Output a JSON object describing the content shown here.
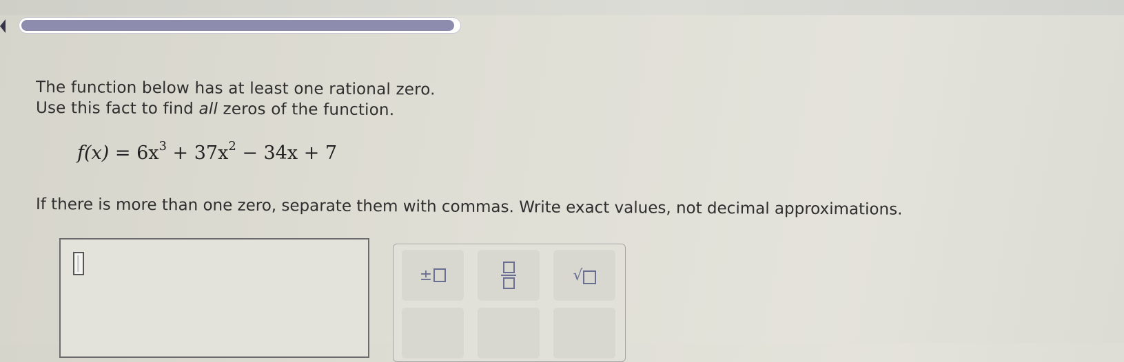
{
  "progress": {
    "value_percent": 99
  },
  "question": {
    "line1": "The function below has at least one rational zero.",
    "line2_before": "Use this fact to find ",
    "line2_emph": "all",
    "line2_after": " zeros of the function.",
    "formula": {
      "lhs": "f(x) = ",
      "t1": "6x",
      "e1": "3",
      "t2": " + 37x",
      "e2": "2",
      "t3": " − 34x + 7"
    },
    "instructions": "If there is more than one zero, separate them with commas. Write exact values, not decimal approximations."
  },
  "answer": {
    "value": ""
  },
  "palette": {
    "buttons": [
      "plus-minus",
      "fraction",
      "square-root"
    ],
    "colors": {
      "icon": "#6a6f92"
    }
  },
  "colors": {
    "progress_fill": "#8d8bae",
    "background": "#e0dfd6"
  }
}
